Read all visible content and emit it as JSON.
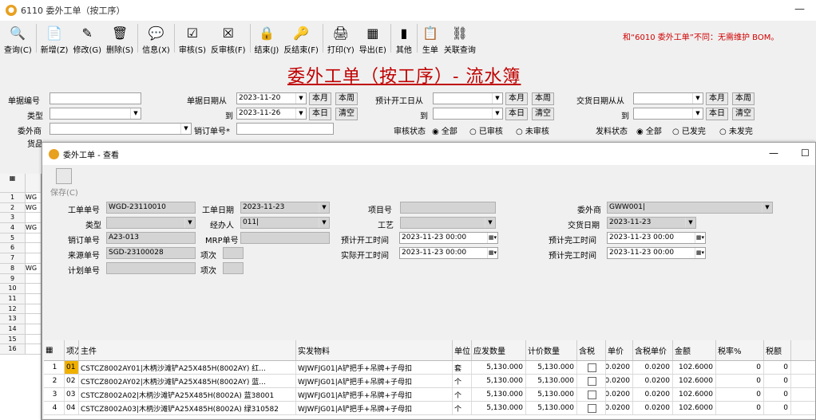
{
  "app": {
    "title": "6110 委外工单（按工序）",
    "minimize": "—"
  },
  "toolbar": [
    {
      "icon": "search-icon",
      "label": "查询(C)",
      "glyph": "🔍"
    },
    {
      "icon": "new-icon",
      "label": "新增(Z)",
      "glyph": "📄"
    },
    {
      "icon": "edit-icon",
      "label": "修改(G)",
      "glyph": "✎"
    },
    {
      "icon": "delete-icon",
      "label": "删除(S)",
      "glyph": "🗑"
    },
    {
      "icon": "message-icon",
      "label": "信息(X)",
      "glyph": "💬"
    },
    {
      "icon": "approve-icon",
      "label": "审核(S)",
      "glyph": "☑"
    },
    {
      "icon": "unapprove-icon",
      "label": "反审核(F)",
      "glyph": "☒"
    },
    {
      "icon": "lock-icon",
      "label": "结束(J)",
      "glyph": "🔒"
    },
    {
      "icon": "key-icon",
      "label": "反结束(F)",
      "glyph": "🔑"
    },
    {
      "icon": "print-icon",
      "label": "打印(Y)",
      "glyph": "🖨"
    },
    {
      "icon": "export-icon",
      "label": "导出(E)",
      "glyph": "▦"
    },
    {
      "icon": "other-icon",
      "label": "其他",
      "glyph": "▮"
    },
    {
      "icon": "generate-icon",
      "label": "生单",
      "glyph": "📋"
    },
    {
      "icon": "link-icon",
      "label": "关联查询",
      "glyph": "⛓"
    }
  ],
  "notice": "和“6010 委外工单”不同：无需维护 BOM。",
  "main_title": "委外工单（按工序）- 流水簿",
  "filters": {
    "doc_no": "单据编号",
    "type": "类型",
    "vendor": "委外商",
    "goods": "货品",
    "doc_date_from": "单据日期从",
    "doc_date_from_val": "2023-11-20",
    "to1": "到",
    "doc_date_to_val": "2023-11-26",
    "sales_order_no": "销订单号*",
    "plan_start_from": "预计开工日从",
    "to2": "到",
    "approve_status": "审核状态",
    "delivery_from": "交货日期从从",
    "to3": "到",
    "issue_status": "发料状态",
    "this_month": "本月",
    "this_week": "本周",
    "today": "本日",
    "clear": "清空",
    "opt_all": "全部",
    "opt_approved": "已审核",
    "opt_unapproved": "未审核",
    "opt_issued": "已发完",
    "opt_not_issued": "未发完"
  },
  "left_grid": {
    "rows": [
      {
        "n": "1",
        "c": "WG"
      },
      {
        "n": "2",
        "c": "WG"
      },
      {
        "n": "3",
        "c": ""
      },
      {
        "n": "4",
        "c": "WG"
      },
      {
        "n": "5",
        "c": ""
      },
      {
        "n": "6",
        "c": ""
      },
      {
        "n": "7",
        "c": ""
      },
      {
        "n": "8",
        "c": "WG"
      },
      {
        "n": "9",
        "c": ""
      },
      {
        "n": "10",
        "c": ""
      },
      {
        "n": "11",
        "c": ""
      },
      {
        "n": "12",
        "c": ""
      },
      {
        "n": "13",
        "c": ""
      },
      {
        "n": "14",
        "c": ""
      },
      {
        "n": "15",
        "c": ""
      },
      {
        "n": "16",
        "c": ""
      }
    ]
  },
  "dialog": {
    "title": "委外工单 - 查看",
    "save": "保存(C)",
    "f": {
      "wo_no_l": "工单单号",
      "wo_no": "WGD-23110010",
      "wo_date_l": "工单日期",
      "wo_date": "2023-11-23",
      "project_l": "项目号",
      "vendor_l": "委外商",
      "vendor": "GWW001|",
      "type_l": "类型",
      "handler_l": "经办人",
      "handler": "011|",
      "process_l": "工艺",
      "delivery_l": "交货日期",
      "delivery": "2023-11-23",
      "so_l": "销订单号",
      "so": "A23-013",
      "mrp_l": "MRP单号",
      "plan_start_l": "预计开工时间",
      "plan_start": "2023-11-23 00:00",
      "plan_end_l": "预计完工时间",
      "plan_end": "2023-11-23 00:00",
      "src_l": "来源单号",
      "src": "SGD-23100028",
      "item1_l": "项次",
      "act_start_l": "实际开工时间",
      "act_start": "2023-11-23 00:00",
      "act_end_l": "预计完工时间",
      "act_end": "2023-11-23 00:00",
      "plan_no_l": "计划单号",
      "item2_l": "项次"
    },
    "grid": {
      "headers": [
        "项次",
        "主件",
        "实发物料",
        "单位",
        "应发数量",
        "计价数量",
        "含税",
        "单价",
        "含税单价",
        "金额",
        "税率%",
        "税额"
      ],
      "rows": [
        {
          "n": "1",
          "seq": "01",
          "main": "CSTCZ8002AY01|木柄沙滩铲A25X485H(8002AY) 红...",
          "mat": "WJWFJG01|A铲把手+吊牌+子母扣",
          "unit": "套",
          "qty": "5,130.000",
          "pqty": "5,130.000",
          "price": "0.0200",
          "tprice": "0.0200",
          "amt": "102.6000",
          "rate": "0",
          "tax": "0"
        },
        {
          "n": "2",
          "seq": "02",
          "main": "CSTCZ8002AY02|木柄沙滩铲A25X485H(8002AY) 蓝...",
          "mat": "WJWFJG01|A铲把手+吊牌+子母扣",
          "unit": "个",
          "qty": "5,130.000",
          "pqty": "5,130.000",
          "price": "0.0200",
          "tprice": "0.0200",
          "amt": "102.6000",
          "rate": "0",
          "tax": "0"
        },
        {
          "n": "3",
          "seq": "03",
          "main": "CSTCZ8002A02|木柄沙滩铲A25X485H(8002A) 蓝38001",
          "mat": "WJWFJG01|A铲把手+吊牌+子母扣",
          "unit": "个",
          "qty": "5,130.000",
          "pqty": "5,130.000",
          "price": "0.0200",
          "tprice": "0.0200",
          "amt": "102.6000",
          "rate": "0",
          "tax": "0"
        },
        {
          "n": "4",
          "seq": "04",
          "main": "CSTCZ8002A03|木柄沙滩铲A25X485H(8002A) 绿310582",
          "mat": "WJWFJG01|A铲把手+吊牌+子母扣",
          "unit": "个",
          "qty": "5,130.000",
          "pqty": "5,130.000",
          "price": "0.0200",
          "tprice": "0.0200",
          "amt": "102.6000",
          "rate": "0",
          "tax": "0"
        }
      ]
    }
  }
}
